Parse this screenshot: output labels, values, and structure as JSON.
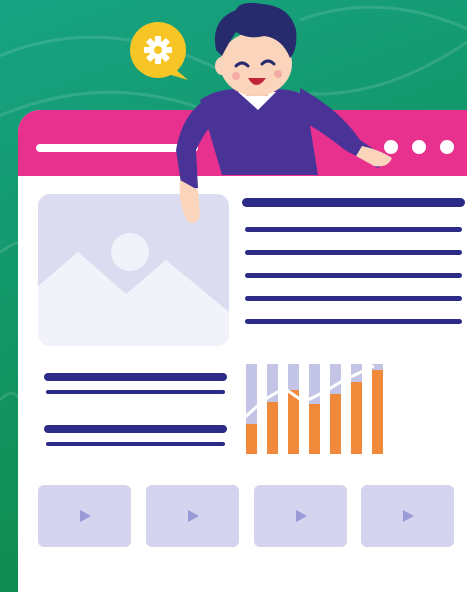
{
  "colors": {
    "background_top": "#159c7e",
    "background_bottom": "#0f8552",
    "titlebar": "#e8318f",
    "text_line": "#2c2c88",
    "placeholder": "#dcdcf0",
    "bar_orange": "#f08a3a",
    "bar_lavender": "#c4c4e6",
    "gear_bubble": "#f7c626",
    "shirt": "#4a3396",
    "hair": "#282a6e",
    "skin": "#fad4bb"
  },
  "icons": {
    "gear": "gear-icon",
    "image": "image-placeholder-icon",
    "play": "play-icon"
  },
  "window_dots": 3,
  "video_tiles": 4
}
